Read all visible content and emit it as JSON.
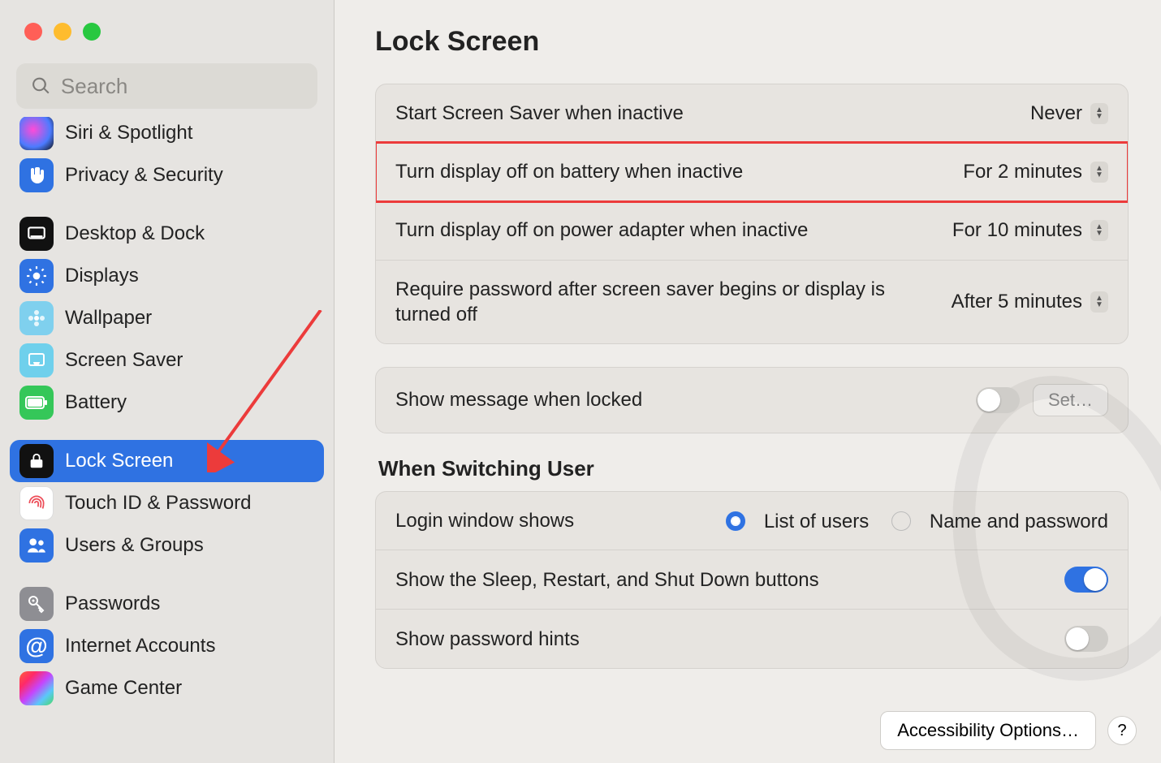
{
  "search": {
    "placeholder": "Search"
  },
  "sidebar": {
    "items": [
      {
        "label": "Siri & Spotlight"
      },
      {
        "label": "Privacy & Security"
      },
      {
        "label": "Desktop & Dock"
      },
      {
        "label": "Displays"
      },
      {
        "label": "Wallpaper"
      },
      {
        "label": "Screen Saver"
      },
      {
        "label": "Battery"
      },
      {
        "label": "Lock Screen"
      },
      {
        "label": "Touch ID & Password"
      },
      {
        "label": "Users & Groups"
      },
      {
        "label": "Passwords"
      },
      {
        "label": "Internet Accounts"
      },
      {
        "label": "Game Center"
      }
    ]
  },
  "main": {
    "title": "Lock Screen",
    "rows": {
      "screensaver": {
        "label": "Start Screen Saver when inactive",
        "value": "Never"
      },
      "battery": {
        "label": "Turn display off on battery when inactive",
        "value": "For 2 minutes"
      },
      "adapter": {
        "label": "Turn display off on power adapter when inactive",
        "value": "For 10 minutes"
      },
      "password": {
        "label": "Require password after screen saver begins or display is turned off",
        "value": "After 5 minutes"
      },
      "message": {
        "label": "Show message when locked",
        "set_btn": "Set…"
      }
    },
    "switching": {
      "title": "When Switching User",
      "login_label": "Login window shows",
      "radio_list": "List of users",
      "radio_namepw": "Name and password",
      "sleep_buttons": "Show the Sleep, Restart, and Shut Down buttons",
      "hints": "Show password hints"
    },
    "bottom": {
      "accessibility": "Accessibility Options…",
      "help": "?"
    }
  }
}
